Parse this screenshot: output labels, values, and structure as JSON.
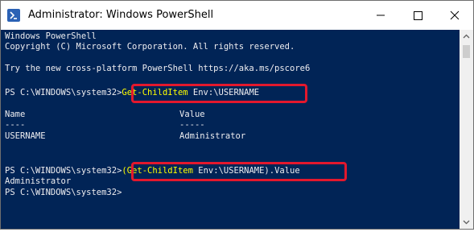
{
  "window": {
    "title": "Administrator: Windows PowerShell",
    "icon": "powershell-icon",
    "controls": [
      "minimize-icon",
      "maximize-icon",
      "close-icon"
    ]
  },
  "console": {
    "banner1": "Windows PowerShell",
    "banner2": "Copyright (C) Microsoft Corporation. All rights reserved.",
    "banner3": "Try the new cross-platform PowerShell https://aka.ms/pscore6",
    "prompt": "PS C:\\WINDOWS\\system32>",
    "cmd1_cmdlet": "Get-ChildItem",
    "cmd1_arg": " Env:\\USERNAME",
    "table_header_name": "Name",
    "table_header_value": "Value",
    "table_sep_name": "----",
    "table_sep_value": "-----",
    "row_name": "USERNAME",
    "row_value": "Administrator",
    "cmd2_open": "(",
    "cmd2_cmdlet": "Get-ChildItem",
    "cmd2_rest": " Env:\\USERNAME).Value",
    "output2": "Administrator"
  },
  "colors": {
    "console_bg": "#012456",
    "console_text": "#eeedf0",
    "cmdlet": "#ffff00",
    "highlight": "#e3182d"
  }
}
